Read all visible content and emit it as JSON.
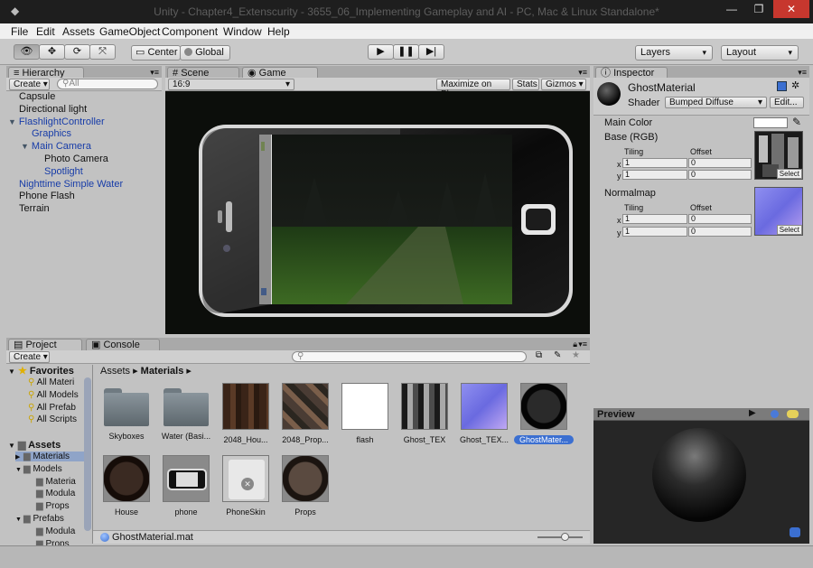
{
  "window": {
    "title": "Unity - Chapter4_Extenscurity - 3655_06_Implementing Gameplay and AI - PC, Mac & Linux Standalone*"
  },
  "menu": [
    "File",
    "Edit",
    "Assets",
    "GameObject",
    "Component",
    "Window",
    "Help"
  ],
  "toolbar": {
    "pivot": "Center",
    "space": "Global",
    "layers": "Layers",
    "layout": "Layout"
  },
  "hierarchy": {
    "tab": "Hierarchy",
    "create": "Create",
    "search_placeholder": "All",
    "items": [
      {
        "label": "Capsule",
        "indent": 0,
        "arrow": "",
        "blue": false
      },
      {
        "label": "Directional light",
        "indent": 0,
        "arrow": "",
        "blue": false
      },
      {
        "label": "FlashlightController",
        "indent": 0,
        "arrow": "▼",
        "blue": true
      },
      {
        "label": "Graphics",
        "indent": 1,
        "arrow": "",
        "blue": true
      },
      {
        "label": "Main Camera",
        "indent": 1,
        "arrow": "▼",
        "blue": true
      },
      {
        "label": "Photo Camera",
        "indent": 2,
        "arrow": "",
        "blue": false
      },
      {
        "label": "Spotlight",
        "indent": 2,
        "arrow": "",
        "blue": true
      },
      {
        "label": "Nighttime Simple Water",
        "indent": 0,
        "arrow": "",
        "blue": true
      },
      {
        "label": "Phone Flash",
        "indent": 0,
        "arrow": "",
        "blue": false
      },
      {
        "label": "Terrain",
        "indent": 0,
        "arrow": "",
        "blue": false
      }
    ]
  },
  "game": {
    "tab_scene": "Scene",
    "tab_game": "Game",
    "aspect": "16:9",
    "maximize": "Maximize on Play",
    "stats": "Stats",
    "gizmos": "Gizmos"
  },
  "inspector": {
    "tab": "Inspector",
    "name": "GhostMaterial",
    "shader_label": "Shader",
    "shader_value": "Bumped Diffuse",
    "edit": "Edit...",
    "main_color": "Main Color",
    "base": "Base (RGB)",
    "tiling": "Tiling",
    "offset": "Offset",
    "x": "x",
    "y": "y",
    "base_tiling_x": "1",
    "base_tiling_y": "1",
    "base_offset_x": "0",
    "base_offset_y": "0",
    "normalmap": "Normalmap",
    "norm_tiling_x": "1",
    "norm_tiling_y": "1",
    "norm_offset_x": "0",
    "norm_offset_y": "0",
    "select": "Select",
    "colors": {
      "main": "#ffffff"
    }
  },
  "preview": {
    "title": "Preview"
  },
  "project": {
    "tab_project": "Project",
    "tab_console": "Console",
    "create": "Create",
    "breadcrumb_root": "Assets",
    "breadcrumb_current": "Materials",
    "favorites_label": "Favorites",
    "favorites": [
      "All Materi",
      "All Models",
      "All Prefab",
      "All Scripts"
    ],
    "assets_label": "Assets",
    "tree": [
      {
        "label": "Materials",
        "indent": 1,
        "arrow": "▶",
        "selected": true
      },
      {
        "label": "Models",
        "indent": 1,
        "arrow": "▼",
        "selected": false
      },
      {
        "label": "Materia",
        "indent": 2,
        "arrow": "",
        "selected": false
      },
      {
        "label": "Modula",
        "indent": 2,
        "arrow": "",
        "selected": false
      },
      {
        "label": "Props",
        "indent": 2,
        "arrow": "",
        "selected": false
      },
      {
        "label": "Prefabs",
        "indent": 1,
        "arrow": "▼",
        "selected": false
      },
      {
        "label": "Modula",
        "indent": 2,
        "arrow": "",
        "selected": false
      },
      {
        "label": "Props",
        "indent": 2,
        "arrow": "",
        "selected": false
      }
    ],
    "assets": [
      {
        "label": "Skyboxes",
        "kind": "folder"
      },
      {
        "label": "Water (Basi...",
        "kind": "folder"
      },
      {
        "label": "2048_Hou...",
        "kind": "tex-house"
      },
      {
        "label": "2048_Prop...",
        "kind": "tex-prop"
      },
      {
        "label": "flash",
        "kind": "white"
      },
      {
        "label": "Ghost_TEX",
        "kind": "ghost"
      },
      {
        "label": "Ghost_TEX...",
        "kind": "normal"
      },
      {
        "label": "GhostMater...",
        "kind": "sphere-dark",
        "selected": true
      },
      {
        "label": "House",
        "kind": "sphere-house"
      },
      {
        "label": "phone",
        "kind": "phone"
      },
      {
        "label": "PhoneSkin",
        "kind": "phoneskin"
      },
      {
        "label": "Props",
        "kind": "sphere-props"
      }
    ],
    "selected_file": "GhostMaterial.mat"
  }
}
